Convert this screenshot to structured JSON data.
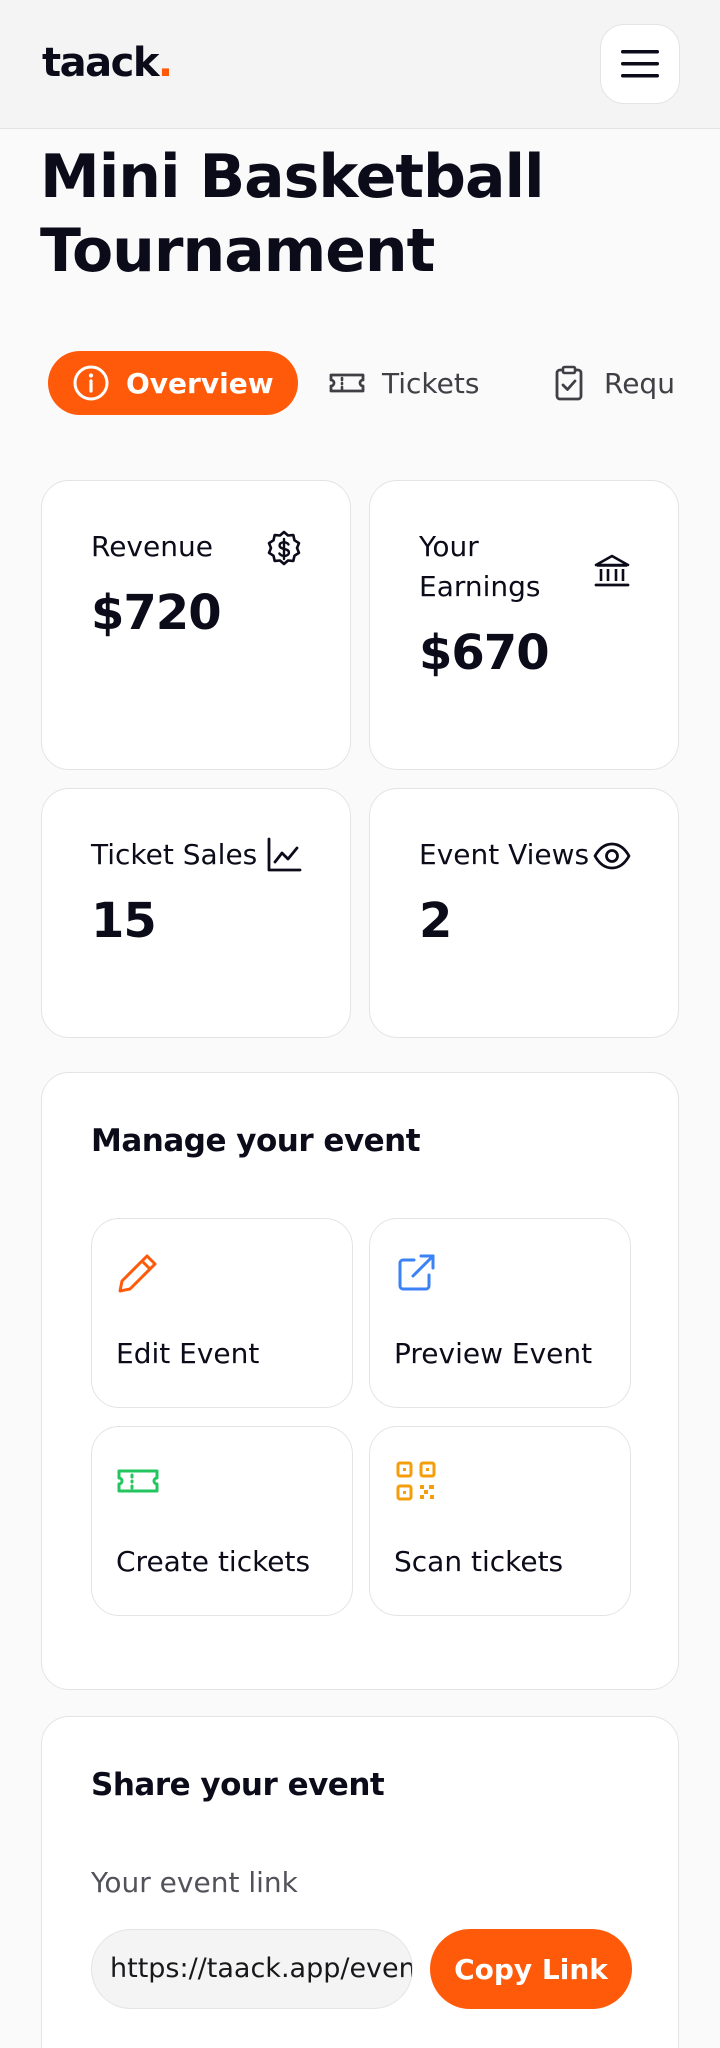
{
  "brand": {
    "name": "taack",
    "dot": ".",
    "accent": "#ff5a0a"
  },
  "header": {
    "menu_icon": "hamburger-menu-icon"
  },
  "event": {
    "title": "Mini Basketball Tournament"
  },
  "tabs": [
    {
      "label": "Overview",
      "icon": "info-circle-icon",
      "active": true
    },
    {
      "label": "Tickets",
      "icon": "ticket-icon",
      "active": false
    },
    {
      "label": "Requ",
      "icon": "clipboard-check-icon",
      "active": false
    }
  ],
  "stats": {
    "revenue": {
      "label": "Revenue",
      "value": "$720",
      "icon": "dollar-badge-icon"
    },
    "earnings": {
      "label": "Your Earnings",
      "value": "$670",
      "icon": "bank-icon"
    },
    "ticket_sales": {
      "label": "Ticket Sales",
      "value": "15",
      "icon": "line-chart-icon"
    },
    "event_views": {
      "label": "Event Views",
      "value": "2",
      "icon": "eye-icon"
    }
  },
  "manage": {
    "title": "Manage your event",
    "actions": [
      {
        "label": "Edit Event",
        "icon": "pencil-icon",
        "color": "#ff5a0a"
      },
      {
        "label": "Preview Event",
        "icon": "external-link-icon",
        "color": "#3b82f6"
      },
      {
        "label": "Create tickets",
        "icon": "ticket-icon",
        "color": "#22c55e"
      },
      {
        "label": "Scan tickets",
        "icon": "qr-code-icon",
        "color": "#f59e0b"
      }
    ]
  },
  "share": {
    "title": "Share your event",
    "link_label": "Your event link",
    "link_value": "https://taack.app/events/mini-basketball-tournament",
    "copy_label": "Copy Link"
  }
}
